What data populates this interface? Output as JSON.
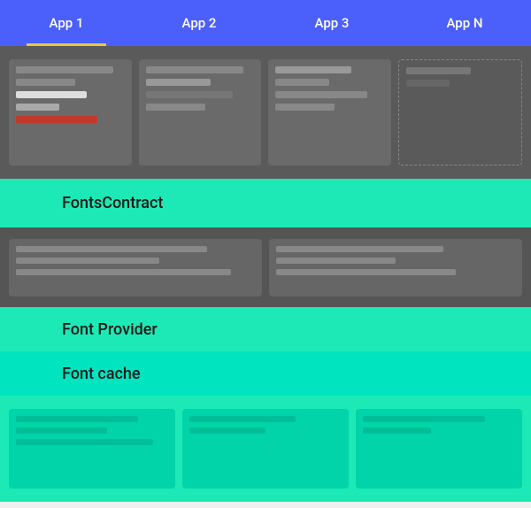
{
  "tabs": [
    {
      "label": "App 1",
      "active": true
    },
    {
      "label": "App 2",
      "active": false
    },
    {
      "label": "App 3",
      "active": false
    },
    {
      "label": "App N",
      "active": false
    }
  ],
  "sections": {
    "fonts_contract": {
      "label": "FontsContract"
    },
    "font_provider": {
      "label": "Font Provider"
    },
    "font_cache": {
      "label": "Font cache"
    }
  },
  "colors": {
    "tab_bar": "#4B5FFA",
    "dark_section": "#555555",
    "teal_primary": "#1DE9B6",
    "teal_secondary": "#00E5C0"
  }
}
